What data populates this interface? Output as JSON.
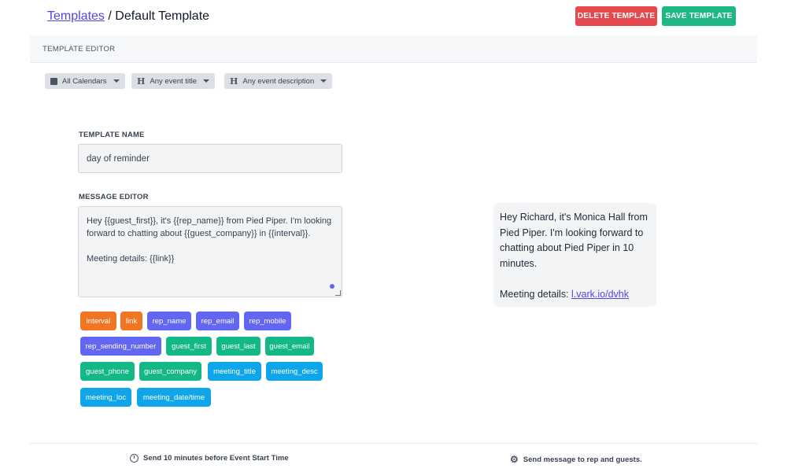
{
  "header": {
    "breadcrumb_link": "Templates",
    "breadcrumb_sep": " / ",
    "breadcrumb_current": "Default Template",
    "delete_label": "DELETE TEMPLATE",
    "save_label": "SAVE TEMPLATE",
    "delete_color": "#e5484d",
    "save_color": "#1fb785"
  },
  "section": {
    "title": "TEMPLATE EDITOR"
  },
  "filters": [
    {
      "icon": "calendar-icon",
      "label": "All Calendars"
    },
    {
      "icon": "heading-icon",
      "label": "Any event title"
    },
    {
      "icon": "heading-icon",
      "label": "Any event description"
    }
  ],
  "template_name": {
    "label": "TEMPLATE NAME",
    "value": "day of reminder"
  },
  "message_editor": {
    "label": "MESSAGE EDITOR",
    "value": "Hey {{guest_first}}, it's {{rep_name}} from Pied Piper. I'm looking forward to chatting about {{guest_company}} in {{interval}}.\n\nMeeting details: {{link}}"
  },
  "tags": [
    {
      "label": "interval",
      "color": "#f27524"
    },
    {
      "label": "link",
      "color": "#f27524"
    },
    {
      "label": "rep_name",
      "color": "#6366f1"
    },
    {
      "label": "rep_email",
      "color": "#6366f1"
    },
    {
      "label": "rep_mobile",
      "color": "#6366f1"
    },
    {
      "label": "rep_sending_number",
      "color": "#6366f1"
    },
    {
      "label": "guest_first",
      "color": "#12b886"
    },
    {
      "label": "guest_last",
      "color": "#12b886"
    },
    {
      "label": "guest_email",
      "color": "#12b886"
    },
    {
      "label": "guest_phone",
      "color": "#12b886"
    },
    {
      "label": "guest_company",
      "color": "#12b886"
    },
    {
      "label": "meeting_title",
      "color": "#0ea5e9"
    },
    {
      "label": "meeting_desc",
      "color": "#0ea5e9"
    },
    {
      "label": "meeting_loc",
      "color": "#0ea5e9"
    },
    {
      "label": "meeting_date/time",
      "color": "#0ea5e9"
    }
  ],
  "preview": {
    "text": "Hey Richard, it's Monica Hall from Pied Piper. I'm looking forward to chatting about Pied Piper in 10 minutes.\n\nMeeting details: ",
    "link": "l.vark.io/dvhk"
  },
  "footer": {
    "timing": "Send 10 minutes before Event Start Time",
    "recipients": "Send message to rep and guests."
  }
}
